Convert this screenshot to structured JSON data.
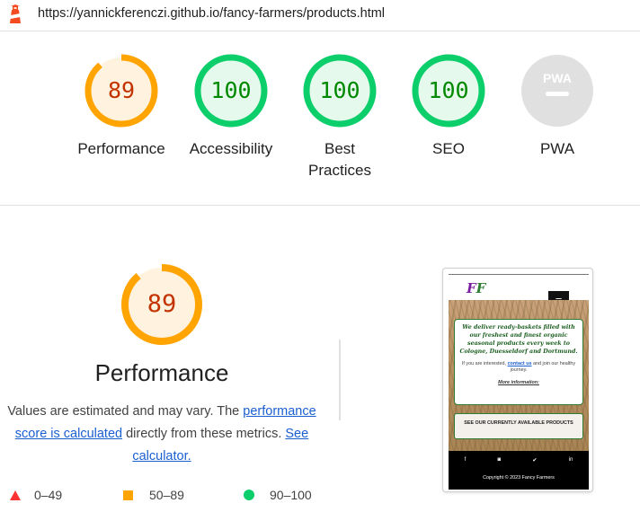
{
  "header": {
    "url": "https://yannickferenczi.github.io/fancy-farmers/products.html",
    "icon": "lighthouse-icon"
  },
  "colors": {
    "average": "#ffa400",
    "average_text": "#c33300",
    "pass": "#0cce6b",
    "pass_text": "#008800",
    "fail": "#ff3333",
    "na": "#cccccc"
  },
  "gauges": [
    {
      "label": "Performance",
      "score": "89",
      "value": 89,
      "status": "average"
    },
    {
      "label": "Accessibility",
      "score": "100",
      "value": 100,
      "status": "pass"
    },
    {
      "label": "Best Practices",
      "score": "100",
      "value": 100,
      "status": "pass"
    },
    {
      "label": "SEO",
      "score": "100",
      "value": 100,
      "status": "pass"
    },
    {
      "label": "PWA",
      "score": "PWA",
      "value": null,
      "status": "na"
    }
  ],
  "performance": {
    "score": "89",
    "value": 89,
    "title": "Performance",
    "desc_prefix": "Values are estimated and may vary. The",
    "desc_link": "performance score is calculated",
    "desc_middle": "directly from these metrics.",
    "calc_link": "See calculator."
  },
  "legend": [
    {
      "range": "0–49",
      "icon": "triangle-icon"
    },
    {
      "range": "50–89",
      "icon": "square-icon"
    },
    {
      "range": "90–100",
      "icon": "circle-icon"
    }
  ],
  "screenshot": {
    "logo_f": "F",
    "logo_f2": "F",
    "menu_icon": "≡",
    "lead": "We deliver ready-baskets filled with our freshest and finest organic seasonal products every week to Cologne, Duesseldorf and Dortmund.",
    "sub_prefix": "If you are interested,",
    "sub_link": "contact us",
    "sub_suffix": "and join our healthy journey.",
    "more": "More information:",
    "cta": "SEE OUR CURRENTLY AVAILABLE PRODUCTS",
    "socials": [
      "f",
      "◙",
      "✔",
      "in"
    ],
    "copyright": "Copyright © 2023 Fancy Farmers"
  }
}
